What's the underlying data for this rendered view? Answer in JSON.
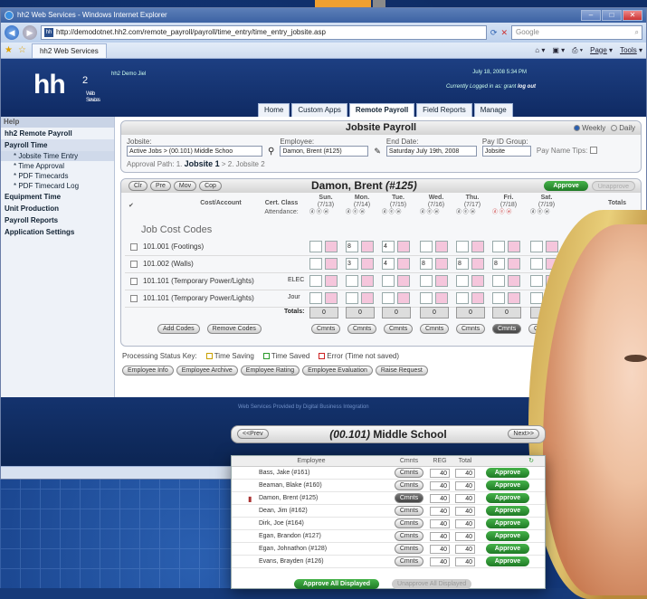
{
  "window": {
    "title": "hh2 Web Services - Windows Internet Explorer",
    "url": "http://demodotnet.hh2.com/remote_payroll/payroll/time_entry/time_entry_jobsite.asp",
    "search_placeholder": "Google",
    "tab_label": "hh2 Web Services",
    "tools": [
      "Page",
      "Tools"
    ]
  },
  "header": {
    "logo": "hh",
    "logo_sup": "2",
    "logo_sub": "Web Services",
    "demo_user": "hh2 Demo Jiel",
    "datetime": "July 18, 2008  5:34 PM",
    "logged_in_text": "Currently Logged in as: grant",
    "logout": "log out",
    "tabs": [
      "Home",
      "Custom Apps",
      "Remote Payroll",
      "Field Reports",
      "Manage"
    ]
  },
  "sidebar": {
    "help": "Help",
    "items": [
      {
        "label": "hh2 Remote Payroll",
        "type": "item"
      },
      {
        "label": "Payroll Time",
        "type": "section"
      },
      {
        "label": "* Jobsite Time Entry",
        "type": "sub",
        "selected": true
      },
      {
        "label": "* Time Approval",
        "type": "sub"
      },
      {
        "label": "* PDF Timecards",
        "type": "sub"
      },
      {
        "label": "* PDF Timecard Log",
        "type": "sub"
      },
      {
        "label": "Equipment Time",
        "type": "item"
      },
      {
        "label": "Unit Production",
        "type": "item"
      },
      {
        "label": "Payroll Reports",
        "type": "item"
      },
      {
        "label": "Application Settings",
        "type": "item"
      }
    ]
  },
  "jobsite": {
    "title": "Jobsite Payroll",
    "weekly": "Weekly",
    "daily": "Daily",
    "jobsite_label": "Jobsite:",
    "jobsite_value": "Active Jobs > (00.101) Middle Schoo",
    "employee_label": "Employee:",
    "employee_value": "Damon, Brent (#125)",
    "end_date_label": "End Date:",
    "end_date_value": "Saturday July 19th, 2008",
    "pay_id_label": "Pay ID Group:",
    "pay_id_value": "Jobsite",
    "pay_name_tips": "Pay Name Tips:",
    "approval_path_label": "Approval Path: 1.",
    "approval_step1": "Jobsite 1",
    "approval_step2": "> 2. Jobsite 2"
  },
  "timesheet": {
    "nav": [
      "Clr",
      "Pre",
      "Mov",
      "Cop"
    ],
    "employee_name": "Damon, Brent",
    "employee_id": "(#125)",
    "approve": "Approve",
    "unapprove": "Unapprove",
    "col_cost": "Cost/Account",
    "col_cert": "Cert. Class",
    "attendance": "Attendance:",
    "days": [
      {
        "d": "Sun.",
        "dt": "(7/13)"
      },
      {
        "d": "Mon.",
        "dt": "(7/14)"
      },
      {
        "d": "Tue.",
        "dt": "(7/15)"
      },
      {
        "d": "Wed.",
        "dt": "(7/16)"
      },
      {
        "d": "Thu.",
        "dt": "(7/17)"
      },
      {
        "d": "Fri.",
        "dt": "(7/18)"
      },
      {
        "d": "Sat.",
        "dt": "(7/19)"
      }
    ],
    "col_totals": "Totals",
    "section_title": "Job Cost Codes",
    "rows": [
      {
        "acct": "101.001 (Footings)",
        "cert": "",
        "vals": [
          "",
          "",
          "8",
          "",
          "4",
          "",
          "",
          "",
          "",
          "",
          "",
          "",
          "",
          ""
        ],
        "total": "5"
      },
      {
        "acct": "101.002 (Walls)",
        "cert": "",
        "vals": [
          "",
          "",
          "3",
          "",
          "4",
          "",
          "8",
          "",
          "8",
          "",
          "8",
          "",
          "",
          ""
        ],
        "total": "31"
      },
      {
        "acct": "101.101 (Temporary Power/Lights)",
        "cert": "ELEC",
        "vals": [
          "",
          "",
          "",
          "",
          "",
          "",
          "",
          "",
          "",
          "",
          "",
          "",
          "",
          ""
        ],
        "total": "0"
      },
      {
        "acct": "101.101 (Temporary Power/Lights)",
        "cert": "Jour",
        "vals": [
          "",
          "",
          "",
          "",
          "",
          "",
          "",
          "",
          "",
          "",
          "",
          "",
          "",
          ""
        ],
        "total": "0"
      }
    ],
    "totals_label": "Totals:",
    "totals": [
      "0",
      "0",
      "0",
      "0",
      "0",
      "0",
      "0"
    ],
    "grand_total": "4",
    "grand_small": "40",
    "add_codes": "Add Codes",
    "remove_codes": "Remove Codes",
    "cmnts": "Cmnts"
  },
  "status_key": {
    "label": "Processing Status Key:",
    "items": [
      {
        "label": "Time Saving",
        "color": "#c8a000"
      },
      {
        "label": "Time Saved",
        "color": "#2a9a2a"
      },
      {
        "label": "Error (Time not saved)",
        "color": "#cc2222"
      }
    ]
  },
  "bottom_buttons": [
    "Employee Info",
    "Employee Archive",
    "Employee Rating",
    "Employee Evaluation",
    "Raise Request"
  ],
  "footer": {
    "provided": "Web Services Provided by Digital Business Integration"
  },
  "popup": {
    "prev": "<<Prev",
    "next": "Next>>",
    "code": "(00.101)",
    "name": "Middle School",
    "col_employee": "Employee",
    "col_cmnts": "Cmnts",
    "col_reg": "REG",
    "col_total": "Total",
    "rows": [
      {
        "name": "Bass, Jake (#161)",
        "reg": "40",
        "total": "40"
      },
      {
        "name": "Beaman, Blake (#160)",
        "reg": "40",
        "total": "40"
      },
      {
        "name": "Damon, Brent (#125)",
        "reg": "40",
        "total": "40",
        "flag": true
      },
      {
        "name": "Dean, Jim (#162)",
        "reg": "40",
        "total": "40"
      },
      {
        "name": "Dirk, Joe (#164)",
        "reg": "40",
        "total": "40"
      },
      {
        "name": "Egan, Brandon (#127)",
        "reg": "40",
        "total": "40"
      },
      {
        "name": "Egan, Johnathon (#128)",
        "reg": "40",
        "total": "40"
      },
      {
        "name": "Evans, Brayden (#126)",
        "reg": "40",
        "total": "40"
      }
    ],
    "cmnts": "Cmnts",
    "approve": "Approve",
    "approve_all": "Approve All Displayed",
    "unapprove_all": "Unapprove All Displayed"
  }
}
